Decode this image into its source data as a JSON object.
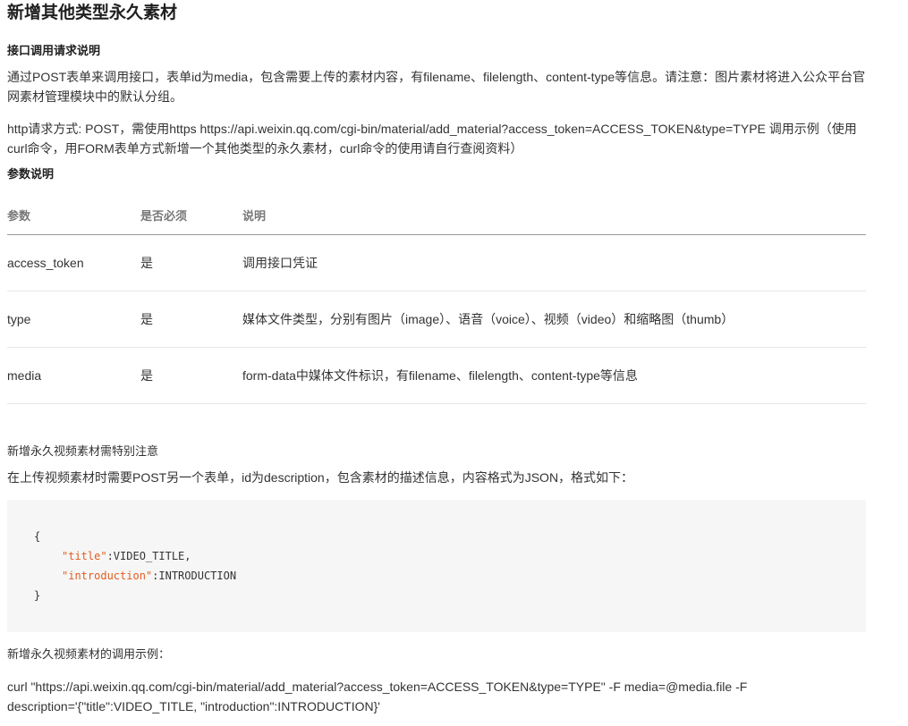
{
  "title": "新增其他类型永久素材",
  "interface_heading": "接口调用请求说明",
  "description_paragraph": "通过POST表单来调用接口，表单id为media，包含需要上传的素材内容，有filename、filelength、content-type等信息。请注意：图片素材将进入公众平台官网素材管理模块中的默认分组。",
  "http_paragraph": "http请求方式: POST，需使用https https://api.weixin.qq.com/cgi-bin/material/add_material?access_token=ACCESS_TOKEN&type=TYPE 调用示例（使用curl命令，用FORM表单方式新增一个其他类型的永久素材，curl命令的使用请自行查阅资料）",
  "params_heading": "参数说明",
  "table": {
    "headers": [
      "参数",
      "是否必须",
      "说明"
    ],
    "rows": [
      [
        "access_token",
        "是",
        "调用接口凭证"
      ],
      [
        "type",
        "是",
        "媒体文件类型，分别有图片（image）、语音（voice）、视频（video）和缩略图（thumb）"
      ],
      [
        "media",
        "是",
        "form-data中媒体文件标识，有filename、filelength、content-type等信息"
      ]
    ]
  },
  "video_note_heading": "新增永久视频素材需特别注意",
  "video_note_paragraph": "在上传视频素材时需要POST另一个表单，id为description，包含素材的描述信息，内容格式为JSON，格式如下：",
  "code": {
    "open_brace": "{",
    "title_key": "\"title\"",
    "title_value": ":VIDEO_TITLE,",
    "intro_key": "\"introduction\"",
    "intro_value": ":INTRODUCTION",
    "close_brace": "}",
    "key_color": "#e25d1f"
  },
  "example_heading": "新增永久视频素材的调用示例：",
  "curl_example": "curl \"https://api.weixin.qq.com/cgi-bin/material/add_material?access_token=ACCESS_TOKEN&type=TYPE\" -F media=@media.file -F description='{\"title\":VIDEO_TITLE, \"introduction\":INTRODUCTION}'"
}
